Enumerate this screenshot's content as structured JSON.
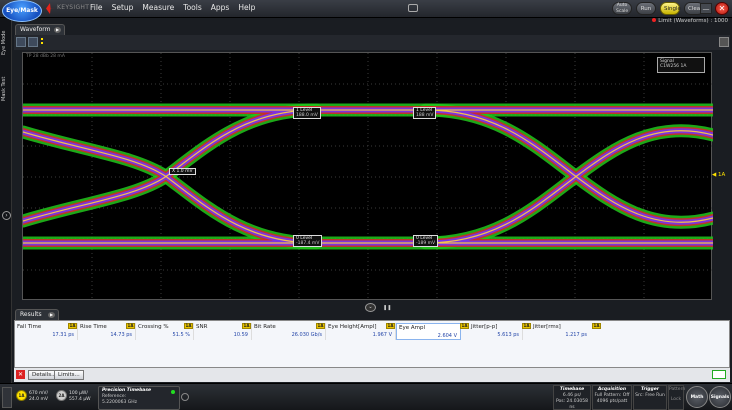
{
  "app": {
    "mode_button": "Eye/Mask",
    "brand": "KEYSIGHT",
    "menu": [
      "File",
      "Setup",
      "Measure",
      "Tools",
      "Apps",
      "Help"
    ],
    "run_controls": {
      "auto_scale": "Auto Scale",
      "run": "Run",
      "single": "Single",
      "clear": "Clear"
    },
    "minimize": "—",
    "close": "✕",
    "limit_status": "Limit (Waveforms) : 1000"
  },
  "side_tabs": [
    "Eye Mode",
    "Mask Test"
  ],
  "waveform": {
    "tab_label": "Waveform",
    "plot_label": "TP 28 dBb 28 mA",
    "signal_legend": {
      "title": "Signal",
      "value": "C1W256 1A"
    },
    "marker_1a": "◀ 1A",
    "markers": [
      {
        "label": "1 Level",
        "value": "188.0 mV"
      },
      {
        "label": "1 Level",
        "value": "188 mV"
      },
      {
        "label": "0 Level",
        "value": "-187.4 mV"
      },
      {
        "label": "0 Level",
        "value": "-189 mV"
      },
      {
        "label": "X 1.0 mV",
        "value": ""
      }
    ],
    "colors": {
      "outer": "#22c61c",
      "mid": "#d02828",
      "inner": "#7a34e6",
      "core": "#ffd040",
      "grid": "#3a3a3a"
    }
  },
  "results": {
    "tab_label": "Results",
    "measurements": [
      {
        "name": "Fall Time",
        "value": "17.31 ps"
      },
      {
        "name": "Rise Time",
        "value": "14.73 ps"
      },
      {
        "name": "Crossing %",
        "value": "51.5 %"
      },
      {
        "name": "SNR",
        "value": "10.59"
      },
      {
        "name": "Bit Rate",
        "value": "26.030 Gb/s"
      },
      {
        "name": "Eye Height[Ampl]",
        "value": "1.967 V"
      },
      {
        "name": "Eye Ampl",
        "value": "2.604 V"
      },
      {
        "name": "Jitter[p-p]",
        "value": "5.613 ps"
      },
      {
        "name": "Jitter[rms]",
        "value": "1.217 ps"
      }
    ],
    "badge": "1A",
    "details_button": "Details...",
    "limits_button": "Limits..."
  },
  "statusbar": {
    "channels": [
      {
        "num": "1A",
        "line1": "670 mV/",
        "line2": "24.0 mV",
        "color": "#ffe300"
      },
      {
        "num": "2A",
        "line1": "100 µW/",
        "line2": "557.4 µW",
        "color": "#cfcfcf"
      }
    ],
    "precision_timebase": {
      "title": "Precision Timebase",
      "line1": "Reference:",
      "line2": "5.2200063 GHz"
    },
    "timebase": {
      "title": "Timebase",
      "line1": "6.46 ps/",
      "line2": "Pos: 24.03058 ns"
    },
    "acquisition": {
      "title": "Acquisition",
      "line1": "Full Pattern: Off",
      "line2": "4096 pts/patt"
    },
    "trigger": {
      "title": "Trigger",
      "line1": "Src: Free Run"
    },
    "pattern": {
      "title": "Pattern",
      "line1": "Lock"
    },
    "math_button": "Math",
    "signals_button": "Signals"
  }
}
